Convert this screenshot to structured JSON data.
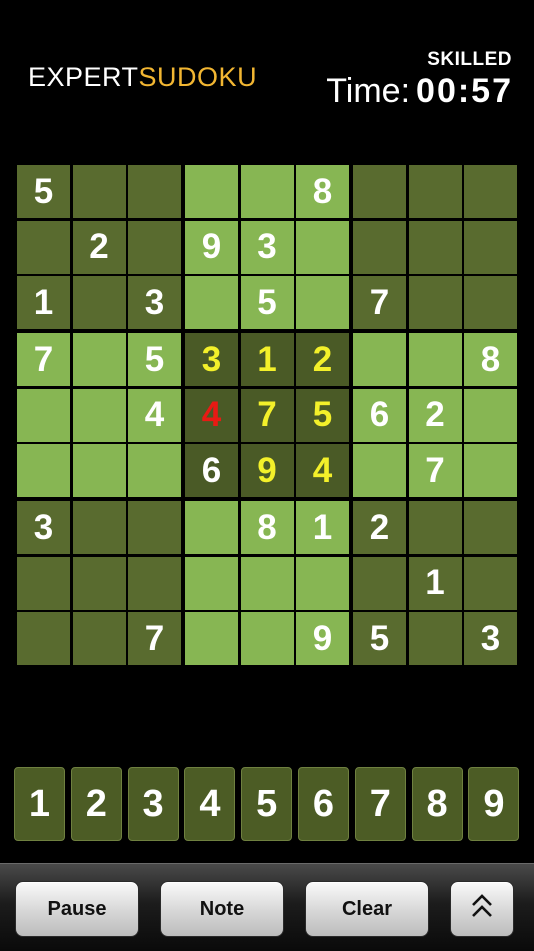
{
  "header": {
    "logo_expert": "EXPERT",
    "logo_sudoku": "SUDOKU",
    "difficulty": "SKILLED",
    "time_label": "Time:",
    "time_value": "00:57"
  },
  "board": {
    "rows": [
      [
        "5",
        "",
        "",
        "",
        "",
        "8",
        "",
        "",
        ""
      ],
      [
        "",
        "2",
        "",
        "9",
        "3",
        "",
        "",
        "",
        ""
      ],
      [
        "1",
        "",
        "3",
        "",
        "5",
        "",
        "7",
        "",
        ""
      ],
      [
        "7",
        "",
        "5",
        "3",
        "1",
        "2",
        "",
        "",
        "8"
      ],
      [
        "",
        "",
        "4",
        "4",
        "7",
        "5",
        "6",
        "2",
        ""
      ],
      [
        "",
        "",
        "",
        "6",
        "9",
        "4",
        "",
        "7",
        ""
      ],
      [
        "3",
        "",
        "",
        "",
        "8",
        "1",
        "2",
        "",
        ""
      ],
      [
        "",
        "",
        "",
        "",
        "",
        "",
        "",
        "1",
        ""
      ],
      [
        "",
        "",
        "7",
        "",
        "",
        "9",
        "5",
        "",
        "3"
      ]
    ],
    "user_cells": [
      [
        3,
        3
      ],
      [
        3,
        4
      ],
      [
        3,
        5
      ],
      [
        4,
        4
      ],
      [
        4,
        5
      ],
      [
        5,
        4
      ],
      [
        5,
        5
      ]
    ],
    "error_cells": [
      [
        4,
        3
      ]
    ],
    "colors": {
      "dark_box": "#596b2f",
      "light_box": "#87b653",
      "selected_box": "#4a5a26",
      "given_digit": "#ffffff",
      "user_digit": "#f3f02a",
      "error_digit": "#e81a14"
    }
  },
  "number_pad": [
    "1",
    "2",
    "3",
    "4",
    "5",
    "6",
    "7",
    "8",
    "9"
  ],
  "toolbar": {
    "pause_label": "Pause",
    "note_label": "Note",
    "clear_label": "Clear",
    "expand_icon": "double-chevron-up-icon"
  }
}
